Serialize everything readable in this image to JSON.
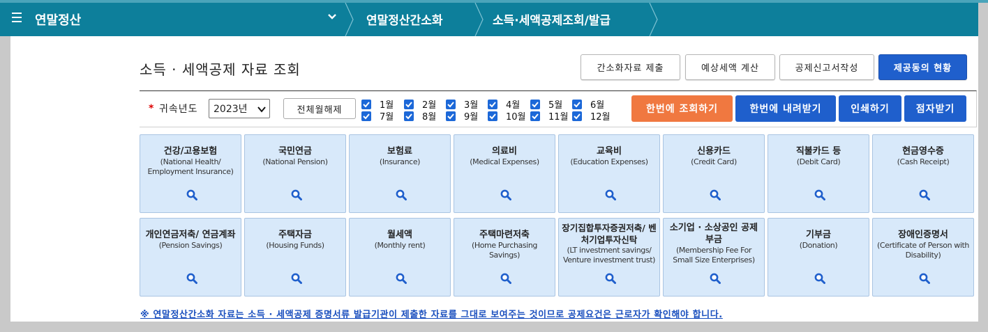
{
  "header": {
    "menu_title": "연말정산",
    "breadcrumbs": [
      "연말정산간소화",
      "소득·세액공제조회/발급"
    ]
  },
  "page": {
    "title": "소득 · 세액공제 자료 조회"
  },
  "toolbar": {
    "submit_simplified": "간소화자료 제출",
    "estimate_tax": "예상세액 계산",
    "write_deduction_form": "공제신고서작성",
    "consent_status": "제공동의 현황"
  },
  "filter": {
    "required_mark": "*",
    "year_label": "귀속년도",
    "year_value": "2023년",
    "deselect_all": "전체월해제",
    "months": [
      "1월",
      "2월",
      "3월",
      "4월",
      "5월",
      "6월",
      "7월",
      "8월",
      "9월",
      "10월",
      "11월",
      "12월"
    ],
    "months_checked": [
      true,
      true,
      true,
      true,
      true,
      true,
      true,
      true,
      true,
      true,
      true,
      true
    ]
  },
  "actions": {
    "query_all": "한번에 조회하기",
    "download_all": "한번에 내려받기",
    "print": "인쇄하기",
    "braille": "점자받기"
  },
  "categories": [
    {
      "kr": "건강/고용보험",
      "en": "(National Health/ Employment Insurance)"
    },
    {
      "kr": "국민연금",
      "en": "(National Pension)"
    },
    {
      "kr": "보험료",
      "en": "(Insurance)"
    },
    {
      "kr": "의료비",
      "en": "(Medical Expenses)"
    },
    {
      "kr": "교육비",
      "en": "(Education Expenses)"
    },
    {
      "kr": "신용카드",
      "en": "(Credit Card)"
    },
    {
      "kr": "직불카드 등",
      "en": "(Debit Card)"
    },
    {
      "kr": "현금영수증",
      "en": "(Cash Receipt)"
    },
    {
      "kr": "개인연금저축/ 연금계좌",
      "en": "(Pension Savings)"
    },
    {
      "kr": "주택자금",
      "en": "(Housing Funds)"
    },
    {
      "kr": "월세액",
      "en": "(Monthly rent)"
    },
    {
      "kr": "주택마련저축",
      "en": "(Home Purchasing Savings)"
    },
    {
      "kr": "장기집합투자증권저축/ 벤처기업투자신탁",
      "en": "(LT investment savings/ Venture investment trust)"
    },
    {
      "kr": "소기업 · 소상공인 공제부금",
      "en": "(Membership Fee For Small Size Enterprises)"
    },
    {
      "kr": "기부금",
      "en": "(Donation)"
    },
    {
      "kr": "장애인증명서",
      "en": "(Certificate of Person with Disability)"
    }
  ],
  "notice": "※ 연말정산간소화 자료는 소득 · 세액공제 증명서류 발급기관이 제출한 자료를 그대로 보여주는 것이므로 공제요건은 근로자가 확인해야 합니다.",
  "colors": {
    "header_bg": "#0d7f9b",
    "primary_blue": "#1f5fcc",
    "orange": "#f07840",
    "tile_bg": "#d8e9fa",
    "notice_blue": "#1a4fbe"
  }
}
